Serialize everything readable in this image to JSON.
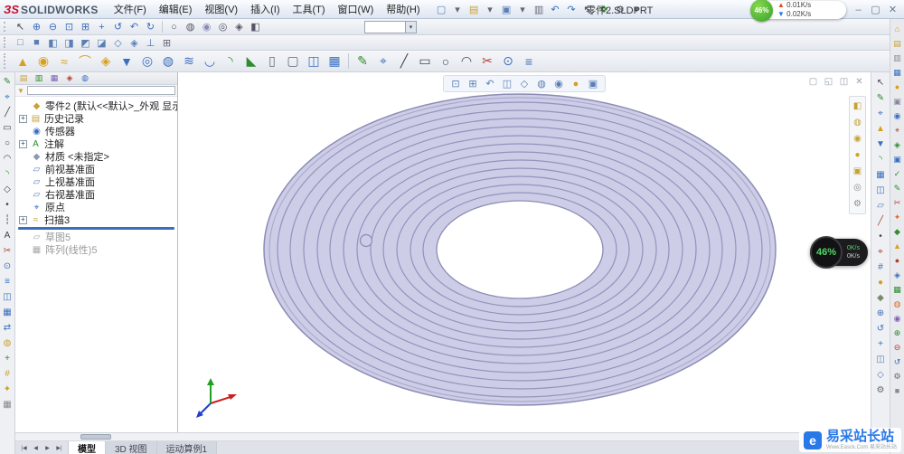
{
  "titlebar": {
    "logo_3s": "ЗS",
    "logo_text": "SOLIDWORKS",
    "menus": [
      "文件(F)",
      "编辑(E)",
      "视图(V)",
      "插入(I)",
      "工具(T)",
      "窗口(W)",
      "帮助(H)"
    ],
    "doc_title": "零件2.SLDPRT",
    "quick_icons": [
      {
        "name": "new-document-icon",
        "glyph": "▢",
        "color": "#5b7fb4"
      },
      {
        "name": "dropdown-arrow-icon",
        "glyph": "▾",
        "color": "#667"
      },
      {
        "name": "open-icon",
        "glyph": "▤",
        "color": "#c8a238"
      },
      {
        "name": "dropdown-arrow-icon",
        "glyph": "▾",
        "color": "#667"
      },
      {
        "name": "save-icon",
        "glyph": "▣",
        "color": "#5b7fb4"
      },
      {
        "name": "dropdown-arrow-icon",
        "glyph": "▾",
        "color": "#667"
      },
      {
        "name": "print-icon",
        "glyph": "▥",
        "color": "#667"
      },
      {
        "name": "undo-icon",
        "glyph": "↶",
        "color": "#3a6fbf"
      },
      {
        "name": "redo-icon",
        "glyph": "↷",
        "color": "#3a6fbf"
      },
      {
        "name": "select-icon",
        "glyph": "↖",
        "color": "#445"
      },
      {
        "name": "rebuild-icon",
        "glyph": "❖",
        "color": "#2e8b2e"
      },
      {
        "name": "options-icon",
        "glyph": "⚙",
        "color": "#667"
      },
      {
        "name": "dropdown-arrow-icon",
        "glyph": "▾",
        "color": "#667"
      }
    ],
    "window_icons": [
      {
        "name": "help-icon",
        "glyph": "?",
        "color": "#6a7a8a"
      },
      {
        "name": "minimize-icon",
        "glyph": "–",
        "color": "#6a7a8a"
      },
      {
        "name": "restore-icon",
        "glyph": "▢",
        "color": "#6a7a8a"
      },
      {
        "name": "close-icon",
        "glyph": "✕",
        "color": "#6a7a8a"
      }
    ]
  },
  "network_widget": {
    "percent": "46%",
    "up_arrow": "▲",
    "up_label": "0.01K/s",
    "down_arrow": "▼",
    "down_label": "0.02K/s"
  },
  "side_widget": {
    "percent": "46%",
    "up": "0K/s",
    "down": "0K/s"
  },
  "toolbars": {
    "combo_value": "",
    "combo_arrow": "▾",
    "row1_view": [
      {
        "name": "select-arrow-icon",
        "glyph": "↖",
        "color": "#445"
      },
      {
        "name": "zoom-in-icon",
        "glyph": "⊕",
        "color": "#3a6fbf"
      },
      {
        "name": "zoom-out-icon",
        "glyph": "⊖",
        "color": "#3a6fbf"
      },
      {
        "name": "zoom-to-fit-icon",
        "glyph": "⊡",
        "color": "#3a6fbf"
      },
      {
        "name": "zoom-to-area-icon",
        "glyph": "⊞",
        "color": "#3a6fbf"
      },
      {
        "name": "pan-icon",
        "glyph": "+",
        "color": "#3a6fbf"
      },
      {
        "name": "rotate-view-icon",
        "glyph": "↺",
        "color": "#3a6fbf"
      },
      {
        "name": "previous-view-icon",
        "glyph": "↶",
        "color": "#3a6fbf"
      },
      {
        "name": "redraw-icon",
        "glyph": "↻",
        "color": "#3a6fbf"
      }
    ],
    "row1_display": [
      {
        "name": "wireframe-icon",
        "glyph": "○",
        "color": "#556"
      },
      {
        "name": "hidden-lines-icon",
        "glyph": "◍",
        "color": "#556"
      },
      {
        "name": "shaded-icon",
        "glyph": "◉",
        "color": "#8a8ab8"
      },
      {
        "name": "shaded-with-edges-icon",
        "glyph": "◎",
        "color": "#556"
      },
      {
        "name": "perspective-icon",
        "glyph": "◈",
        "color": "#556"
      },
      {
        "name": "shadows-icon",
        "glyph": "◧",
        "color": "#556"
      }
    ],
    "row2_views": [
      {
        "name": "front-view-icon",
        "glyph": "□",
        "color": "#5b7fb4"
      },
      {
        "name": "back-view-icon",
        "glyph": "■",
        "color": "#5b7fb4"
      },
      {
        "name": "left-view-icon",
        "glyph": "◧",
        "color": "#5b7fb4"
      },
      {
        "name": "right-view-icon",
        "glyph": "◨",
        "color": "#5b7fb4"
      },
      {
        "name": "top-view-icon",
        "glyph": "◩",
        "color": "#5b7fb4"
      },
      {
        "name": "bottom-view-icon",
        "glyph": "◪",
        "color": "#5b7fb4"
      },
      {
        "name": "isometric-view-icon",
        "glyph": "◇",
        "color": "#5b7fb4"
      },
      {
        "name": "dimetric-view-icon",
        "glyph": "◈",
        "color": "#5b7fb4"
      },
      {
        "name": "normal-to-icon",
        "glyph": "⊥",
        "color": "#3a6fbf"
      },
      {
        "name": "four-viewport-icon",
        "glyph": "⊞",
        "color": "#667"
      }
    ],
    "row3_features": [
      {
        "name": "extruded-boss-icon",
        "glyph": "▲",
        "color": "#d8a020"
      },
      {
        "name": "revolved-boss-icon",
        "glyph": "◉",
        "color": "#d8a020"
      },
      {
        "name": "swept-boss-icon",
        "glyph": "≈",
        "color": "#d8a020"
      },
      {
        "name": "lofted-boss-icon",
        "glyph": "⌒",
        "color": "#d8a020"
      },
      {
        "name": "boundary-boss-icon",
        "glyph": "◈",
        "color": "#d8a020"
      },
      {
        "name": "extruded-cut-icon",
        "glyph": "▼",
        "color": "#3a6fbf"
      },
      {
        "name": "hole-wizard-icon",
        "glyph": "◎",
        "color": "#3a6fbf"
      },
      {
        "name": "revolved-cut-icon",
        "glyph": "◍",
        "color": "#3a6fbf"
      },
      {
        "name": "swept-cut-icon",
        "glyph": "≋",
        "color": "#3a6fbf"
      },
      {
        "name": "lofted-cut-icon",
        "glyph": "◡",
        "color": "#3a6fbf"
      },
      {
        "name": "fillet-icon",
        "glyph": "◝",
        "color": "#2e8b2e"
      },
      {
        "name": "chamfer-icon",
        "glyph": "◣",
        "color": "#2e8b2e"
      },
      {
        "name": "rib-icon",
        "glyph": "▯",
        "color": "#667"
      },
      {
        "name": "shell-icon",
        "glyph": "▢",
        "color": "#667"
      },
      {
        "name": "mirror-icon",
        "glyph": "◫",
        "color": "#3a6fbf"
      },
      {
        "name": "linear-pattern-icon",
        "glyph": "▦",
        "color": "#3a6fbf"
      }
    ],
    "row3_sketch": [
      {
        "name": "sketch-icon",
        "glyph": "✎",
        "color": "#2e8b2e"
      },
      {
        "name": "smart-dimension-icon",
        "glyph": "⌖",
        "color": "#3a6fbf"
      },
      {
        "name": "line-icon",
        "glyph": "╱",
        "color": "#445"
      },
      {
        "name": "rectangle-icon",
        "glyph": "▭",
        "color": "#445"
      },
      {
        "name": "circle-icon",
        "glyph": "○",
        "color": "#445"
      },
      {
        "name": "arc-icon",
        "glyph": "◠",
        "color": "#445"
      },
      {
        "name": "trim-entities-icon",
        "glyph": "✂",
        "color": "#b04030"
      },
      {
        "name": "convert-entities-icon",
        "glyph": "⊙",
        "color": "#3a6fbf"
      },
      {
        "name": "offset-entities-icon",
        "glyph": "≡",
        "color": "#3a6fbf"
      }
    ]
  },
  "left_strip": [
    {
      "name": "edit-sketch-icon",
      "glyph": "✎",
      "color": "#2e8b2e"
    },
    {
      "name": "smart-dimension-icon",
      "glyph": "⌖",
      "color": "#3a6fbf"
    },
    {
      "name": "line-icon",
      "glyph": "╱",
      "color": "#444"
    },
    {
      "name": "corner-rectangle-icon",
      "glyph": "▭",
      "color": "#444"
    },
    {
      "name": "circle-icon",
      "glyph": "○",
      "color": "#444"
    },
    {
      "name": "centerpoint-arc-icon",
      "glyph": "◠",
      "color": "#444"
    },
    {
      "name": "sketch-fillet-icon",
      "glyph": "◝",
      "color": "#2e8b2e"
    },
    {
      "name": "polygon-icon",
      "glyph": "◇",
      "color": "#444"
    },
    {
      "name": "point-icon",
      "glyph": "•",
      "color": "#444"
    },
    {
      "name": "centerline-icon",
      "glyph": "┆",
      "color": "#444"
    },
    {
      "name": "text-icon",
      "glyph": "A",
      "color": "#444"
    },
    {
      "name": "trim-entities-icon",
      "glyph": "✂",
      "color": "#b04030"
    },
    {
      "name": "convert-entities-icon",
      "glyph": "⊙",
      "color": "#3a6fbf"
    },
    {
      "name": "offset-entities-icon",
      "glyph": "≡",
      "color": "#3a6fbf"
    },
    {
      "name": "mirror-entities-icon",
      "glyph": "◫",
      "color": "#3a6fbf"
    },
    {
      "name": "linear-sketch-pattern-icon",
      "glyph": "▦",
      "color": "#3a6fbf"
    },
    {
      "name": "move-entities-icon",
      "glyph": "⇄",
      "color": "#3a6fbf"
    },
    {
      "name": "display-delete-relations-icon",
      "glyph": "◍",
      "color": "#c8a238"
    },
    {
      "name": "repair-sketch-icon",
      "glyph": "+",
      "color": "#2e8b2e"
    },
    {
      "name": "quick-snaps-icon",
      "glyph": "#",
      "color": "#c8a238"
    },
    {
      "name": "rapid-sketch-icon",
      "glyph": "✦",
      "color": "#c8a238"
    },
    {
      "name": "grid-settings-icon",
      "glyph": "▦",
      "color": "#888"
    }
  ],
  "feature_tree": {
    "chevron": "»",
    "funnel_glyph": "▼",
    "tabs_icons": [
      {
        "name": "featuremanager-tab-icon",
        "glyph": "▤",
        "color": "#c8a238"
      },
      {
        "name": "propertymanager-tab-icon",
        "glyph": "▥",
        "color": "#2e8b2e"
      },
      {
        "name": "configurationmanager-tab-icon",
        "glyph": "▦",
        "color": "#7a5fb4"
      },
      {
        "name": "dimxpert-tab-icon",
        "glyph": "◈",
        "color": "#b04030"
      },
      {
        "name": "displaymanager-tab-icon",
        "glyph": "◍",
        "color": "#3a6fbf"
      }
    ],
    "root": {
      "label": "零件2 (默认<<默认>_外观 显示",
      "glyph": "◆"
    },
    "items": [
      {
        "id": "history",
        "label": "历史记录",
        "glyph": "▤",
        "color": "#c8a238",
        "plus": true
      },
      {
        "id": "sensors",
        "label": "传感器",
        "glyph": "◉",
        "color": "#3a6fbf"
      },
      {
        "id": "annotations",
        "label": "注解",
        "glyph": "A",
        "color": "#2e8b2e",
        "plus": true
      },
      {
        "id": "material",
        "label": "材质 <未指定>",
        "glyph": "◆",
        "color": "#8a9ab0"
      },
      {
        "id": "front-plane",
        "label": "前视基准面",
        "glyph": "▱",
        "color": "#5b7fb4"
      },
      {
        "id": "top-plane",
        "label": "上视基准面",
        "glyph": "▱",
        "color": "#5b7fb4"
      },
      {
        "id": "right-plane",
        "label": "右视基准面",
        "glyph": "▱",
        "color": "#5b7fb4"
      },
      {
        "id": "origin",
        "label": "原点",
        "glyph": "⌖",
        "color": "#3a6fbf"
      },
      {
        "id": "sweep3",
        "label": "扫描3",
        "glyph": "≈",
        "color": "#c8a238",
        "plus": true,
        "rollbackAfter": true
      },
      {
        "id": "sketch5",
        "label": "草图5",
        "glyph": "▱",
        "color": "#aaaaaa",
        "gray": true
      },
      {
        "id": "pattern-linear5",
        "label": "阵列(线性)5",
        "glyph": "▦",
        "color": "#aaaaaa",
        "gray": true
      }
    ]
  },
  "viewport": {
    "hud_icons": [
      {
        "name": "zoom-to-fit-icon",
        "glyph": "⊡",
        "color": "#5b7fb4"
      },
      {
        "name": "zoom-to-area-icon",
        "glyph": "⊞",
        "color": "#5b7fb4"
      },
      {
        "name": "previous-view-icon",
        "glyph": "↶",
        "color": "#5b7fb4"
      },
      {
        "name": "section-view-icon",
        "glyph": "◫",
        "color": "#5b7fb4"
      },
      {
        "name": "view-orientation-icon",
        "glyph": "◇",
        "color": "#5b7fb4"
      },
      {
        "name": "display-style-icon",
        "glyph": "◍",
        "color": "#5b7fb4"
      },
      {
        "name": "hide-show-items-icon",
        "glyph": "◉",
        "color": "#5b7fb4"
      },
      {
        "name": "edit-appearance-icon",
        "glyph": "●",
        "color": "#d8a020"
      },
      {
        "name": "apply-scene-icon",
        "glyph": "▣",
        "color": "#5b7fb4"
      }
    ],
    "corner_icons": [
      {
        "name": "viewport-minimize-icon",
        "glyph": "▢",
        "color": "#98a2b0"
      },
      {
        "name": "viewport-restore-icon",
        "glyph": "◱",
        "color": "#98a2b0"
      },
      {
        "name": "viewport-split-icon",
        "glyph": "◫",
        "color": "#98a2b0"
      },
      {
        "name": "viewport-close-icon",
        "glyph": "✕",
        "color": "#98a2b0"
      }
    ],
    "float_icons": [
      {
        "name": "view-orientation-icon",
        "glyph": "◧",
        "color": "#c8a238"
      },
      {
        "name": "display-style-icon",
        "glyph": "◍",
        "color": "#c8a238"
      },
      {
        "name": "hide-show-items-icon",
        "glyph": "◉",
        "color": "#c8a238"
      },
      {
        "name": "edit-appearance-icon",
        "glyph": "●",
        "color": "#d8a020"
      },
      {
        "name": "apply-scene-icon",
        "glyph": "▣",
        "color": "#c8a238"
      },
      {
        "name": "camera-view-icon",
        "glyph": "◎",
        "color": "#8a8a8a"
      },
      {
        "name": "view-settings-icon",
        "glyph": "⚙",
        "color": "#8a8a8a"
      }
    ]
  },
  "right_strip_mid": [
    {
      "name": "select-arrow-icon",
      "glyph": "↖",
      "color": "#445"
    },
    {
      "name": "sketch-icon",
      "glyph": "✎",
      "color": "#2e8b2e"
    },
    {
      "name": "smart-dimension-icon",
      "glyph": "⌖",
      "color": "#3a6fbf"
    },
    {
      "name": "extruded-boss-icon",
      "glyph": "▲",
      "color": "#d8a020"
    },
    {
      "name": "extruded-cut-icon",
      "glyph": "▼",
      "color": "#3a6fbf"
    },
    {
      "name": "fillet-icon",
      "glyph": "◝",
      "color": "#2e8b2e"
    },
    {
      "name": "linear-pattern-icon",
      "glyph": "▦",
      "color": "#3a6fbf"
    },
    {
      "name": "mirror-icon",
      "glyph": "◫",
      "color": "#3a6fbf"
    },
    {
      "name": "reference-plane-icon",
      "glyph": "▱",
      "color": "#5b7fb4"
    },
    {
      "name": "reference-axis-icon",
      "glyph": "╱",
      "color": "#b04030"
    },
    {
      "name": "reference-point-icon",
      "glyph": "•",
      "color": "#445"
    },
    {
      "name": "coordinate-system-icon",
      "glyph": "⌖",
      "color": "#b04030"
    },
    {
      "name": "measure-icon",
      "glyph": "#",
      "color": "#3a6fbf"
    },
    {
      "name": "appearance-icon",
      "glyph": "●",
      "color": "#d8a020"
    },
    {
      "name": "material-icon",
      "glyph": "◆",
      "color": "#7a8a6a"
    },
    {
      "name": "zoom-in-icon",
      "glyph": "⊕",
      "color": "#3a6fbf"
    },
    {
      "name": "rotate-view-icon",
      "glyph": "↺",
      "color": "#3a6fbf"
    },
    {
      "name": "pan-icon",
      "glyph": "+",
      "color": "#3a6fbf"
    },
    {
      "name": "section-view-icon",
      "glyph": "◫",
      "color": "#5b7fb4"
    },
    {
      "name": "isometric-view-icon",
      "glyph": "◇",
      "color": "#5b7fb4"
    },
    {
      "name": "settings-icon",
      "glyph": "⚙",
      "color": "#667"
    }
  ],
  "right_strip_far": [
    {
      "name": "solidworks-resources-icon",
      "glyph": "⌂",
      "color": "#c8a238"
    },
    {
      "name": "design-library-icon",
      "glyph": "▤",
      "color": "#c8a238"
    },
    {
      "name": "file-explorer-icon",
      "glyph": "▥",
      "color": "#889"
    },
    {
      "name": "view-palette-icon",
      "glyph": "▦",
      "color": "#3a6fbf"
    },
    {
      "name": "appearances-scenes-icon",
      "glyph": "●",
      "color": "#d8a020"
    },
    {
      "name": "custom-properties-icon",
      "glyph": "▣",
      "color": "#889"
    },
    {
      "name": "forum-icon",
      "glyph": "◉",
      "color": "#3a6fbf"
    },
    {
      "name": "measure-icon",
      "glyph": "⌖",
      "color": "#b04030"
    },
    {
      "name": "mass-properties-icon",
      "glyph": "◈",
      "color": "#2e8b2e"
    },
    {
      "name": "section-properties-icon",
      "glyph": "▣",
      "color": "#3a6fbf"
    },
    {
      "name": "check-icon",
      "glyph": "✓",
      "color": "#2e8b2e"
    },
    {
      "name": "sketch-tool-icon",
      "glyph": "✎",
      "color": "#2e8b2e"
    },
    {
      "name": "trim-tool-icon",
      "glyph": "✂",
      "color": "#b04030"
    },
    {
      "name": "star-tool-icon",
      "glyph": "✦",
      "color": "#e06a2b"
    },
    {
      "name": "diamond-tool-icon",
      "glyph": "◆",
      "color": "#2e8b2e"
    },
    {
      "name": "triangle-tool-icon",
      "glyph": "▲",
      "color": "#d8a020"
    },
    {
      "name": "dot-tool-icon",
      "glyph": "●",
      "color": "#b04030"
    },
    {
      "name": "lozenge-tool-icon",
      "glyph": "◈",
      "color": "#3a6fbf"
    },
    {
      "name": "grid-tool-icon",
      "glyph": "▦",
      "color": "#2e8b2e"
    },
    {
      "name": "circle-tool-icon",
      "glyph": "◍",
      "color": "#e06a2b"
    },
    {
      "name": "target-tool-icon",
      "glyph": "◉",
      "color": "#7a5fb4"
    },
    {
      "name": "zoom-in-tool-icon",
      "glyph": "⊕",
      "color": "#2e8b2e"
    },
    {
      "name": "zoom-out-tool-icon",
      "glyph": "⊖",
      "color": "#b04030"
    },
    {
      "name": "rotate-tool-icon",
      "glyph": "↺",
      "color": "#3a6fbf"
    },
    {
      "name": "gear-icon",
      "glyph": "⚙",
      "color": "#667"
    },
    {
      "name": "square-tool-icon",
      "glyph": "■",
      "color": "#889"
    }
  ],
  "bottom": {
    "tab_arrows": [
      {
        "name": "first-tab-icon",
        "glyph": "|◀",
        "color": "#556"
      },
      {
        "name": "prev-tab-icon",
        "glyph": "◀",
        "color": "#556"
      },
      {
        "name": "next-tab-icon",
        "glyph": "▶",
        "color": "#556"
      },
      {
        "name": "last-tab-icon",
        "glyph": "▶|",
        "color": "#556"
      }
    ],
    "tabs": {
      "items": [
        "模型",
        "3D 视图",
        "运动算例1"
      ],
      "active": 0
    }
  },
  "watermark": {
    "logo": "e",
    "title": "易采站长站",
    "subtitle": "Www.Easck.Com 易采站长站"
  }
}
